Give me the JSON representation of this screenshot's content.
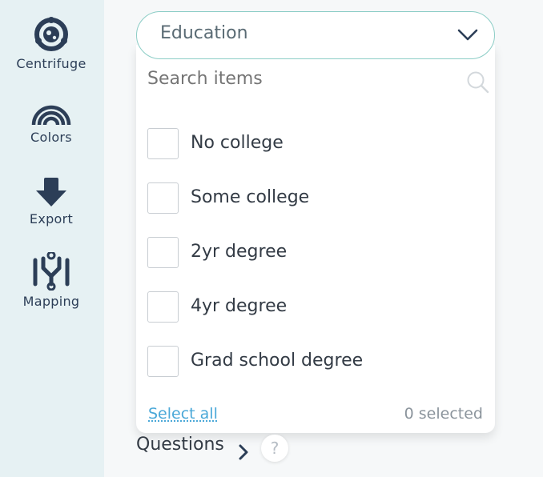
{
  "sidebar": {
    "items": [
      {
        "label": "Centrifuge",
        "icon": "centrifuge-icon"
      },
      {
        "label": "Colors",
        "icon": "rainbow-icon"
      },
      {
        "label": "Export",
        "icon": "download-arrow-icon"
      },
      {
        "label": "Mapping",
        "icon": "mapping-icon"
      }
    ]
  },
  "dropdown": {
    "selected_value": "Education",
    "search_placeholder": "Search items",
    "options": [
      {
        "label": "No college",
        "checked": false
      },
      {
        "label": "Some college",
        "checked": false
      },
      {
        "label": "2yr degree",
        "checked": false
      },
      {
        "label": "4yr degree",
        "checked": false
      },
      {
        "label": "Grad school degree",
        "checked": false
      }
    ],
    "select_all_label": "Select all",
    "selected_count_text": "0 selected"
  },
  "questions": {
    "label": "Questions",
    "help_symbol": "?"
  },
  "colors": {
    "sidebar_bg": "#e6f1f3",
    "icon_navy": "#2c3e57",
    "dropdown_border": "#8ccdc6",
    "link_blue": "#4aa8d8"
  }
}
